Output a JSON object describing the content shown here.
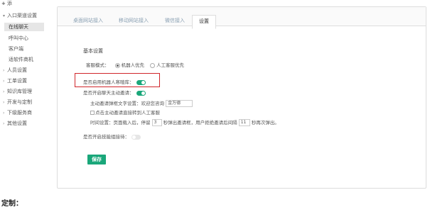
{
  "top": {
    "plus": "+",
    "label": "添"
  },
  "sidebar": {
    "groups": [
      {
        "arrow": "▾",
        "label": "入口渠道设置"
      },
      {
        "arrow": "›",
        "label": "人员设置"
      },
      {
        "arrow": "›",
        "label": "工单设置"
      },
      {
        "arrow": "›",
        "label": "知识库管理"
      },
      {
        "arrow": "›",
        "label": "开发与定制"
      },
      {
        "arrow": "›",
        "label": "下级服务商"
      },
      {
        "arrow": "›",
        "label": "其他设置"
      }
    ],
    "subitems": [
      "在线聊天",
      "呼叫中心",
      "客户端",
      "适软件商机"
    ]
  },
  "tabs": [
    "桌面网站接入",
    "移动网站接入",
    "微信接入",
    "设置"
  ],
  "settings": {
    "section_title": "基本设置",
    "service_mode_label": "客服模式：",
    "option_robot": "机器人优先",
    "option_human": "人工客服优先",
    "robot_toggle_label": "是否启用机器人寒暄库：",
    "invite_toggle_label": "是否开启聊天主动邀请：",
    "invite_text_label": "主动邀请弹框文字设置：欢迎您咨询",
    "invite_text_value": "金万德",
    "transfer_checkbox_label": "点击主动邀请直接转到人工客服",
    "time_prefix": "时间设置：页面载入后，停留",
    "time_value1": "3",
    "time_mid": "秒弹出邀请框，用户拒绝邀请后间隔",
    "time_value2": "11",
    "time_suffix": "秒再次弹出。",
    "skill_toggle_label": "是否开启技能组接待："
  },
  "save_label": "保存",
  "bottom_text": "定制：",
  "colors": {
    "accent": "#1aa77a",
    "highlight": "#d0262b"
  }
}
